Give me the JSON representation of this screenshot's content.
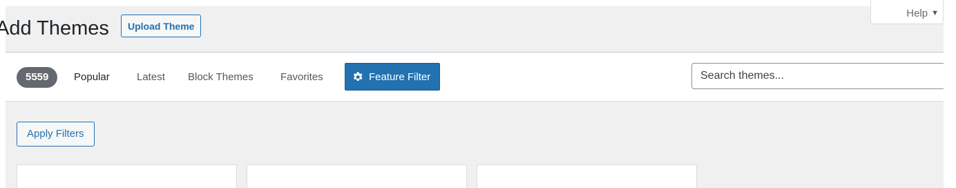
{
  "header": {
    "title": "Add Themes",
    "upload_label": "Upload Theme",
    "help_label": "Help",
    "help_caret": "▼"
  },
  "filter_bar": {
    "count": "5559",
    "links": [
      "Popular",
      "Latest",
      "Block Themes",
      "Favorites"
    ],
    "current": "Popular",
    "feature_filter_label": "Feature Filter",
    "search_placeholder": "Search themes..."
  },
  "filters": {
    "apply_label": "Apply Filters"
  },
  "colors": {
    "accent": "#2271b1",
    "badge": "#646970",
    "background": "#f0f0f1"
  },
  "icons": {
    "feature_filter": "gear-icon",
    "help": "caret-down-icon"
  }
}
